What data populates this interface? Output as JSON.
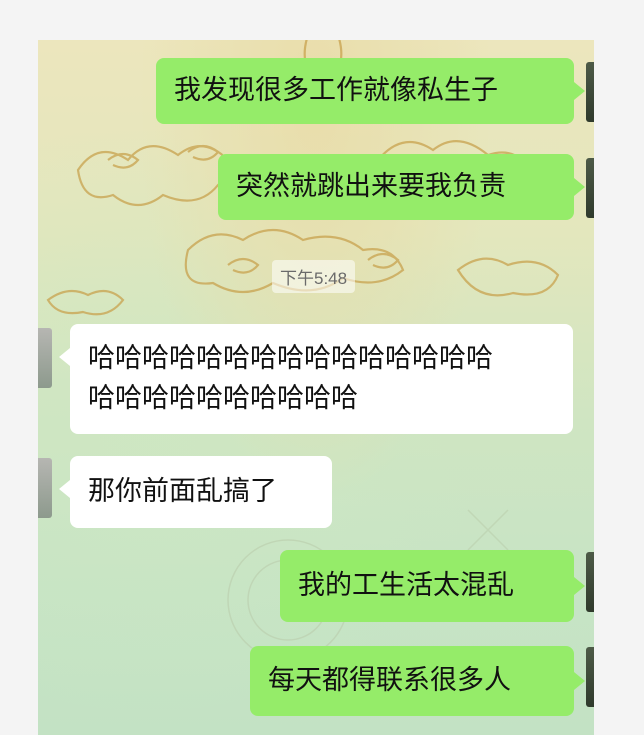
{
  "conversation": {
    "time_divider": "下午5:48",
    "messages": [
      {
        "side": "sent",
        "text": "我发现很多工作就像私生子"
      },
      {
        "side": "sent",
        "text": "突然就跳出来要我负责"
      },
      {
        "side": "received",
        "line1": "哈哈哈哈哈哈哈哈哈哈哈哈哈哈哈",
        "line2": "哈哈哈哈哈哈哈哈哈哈"
      },
      {
        "side": "received",
        "text": "那你前面乱搞了"
      },
      {
        "side": "sent",
        "text": "我的工生活太混乱"
      },
      {
        "side": "sent",
        "text": "每天都得联系很多人"
      }
    ]
  },
  "colors": {
    "sent_bubble": "#95ec69",
    "received_bubble": "#ffffff",
    "wallpaper": "#cfe5c2"
  },
  "icons": [
    "avatar-strip"
  ]
}
